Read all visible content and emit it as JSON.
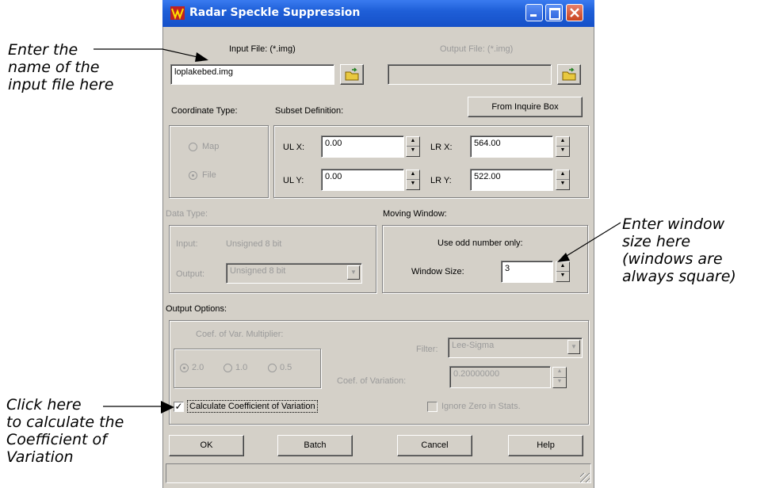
{
  "callouts": {
    "input": [
      "Enter the",
      "name of the",
      "input file here"
    ],
    "window": [
      "Enter window",
      "size here",
      "(windows are",
      "always square)"
    ],
    "coef": [
      "Click here",
      "to calculate the",
      "Coefficient of",
      "Variation"
    ]
  },
  "window": {
    "title": "Radar Speckle Suppression",
    "app_icon": "imagine-icon",
    "title_buttons": [
      "minimize",
      "maximize",
      "close"
    ]
  },
  "input_file": {
    "label": "Input File: (*.img)",
    "value": "loplakebed.img"
  },
  "output_file": {
    "label": "Output File: (*.img)",
    "value": ""
  },
  "from_inquire_box": "From Inquire Box",
  "coordinate_type": {
    "label": "Coordinate Type:",
    "options": [
      "Map",
      "File"
    ],
    "selected": "File"
  },
  "subset": {
    "label": "Subset Definition:",
    "ulx_label": "UL X:",
    "ulx": "0.00",
    "uly_label": "UL Y:",
    "uly": "0.00",
    "lrx_label": "LR X:",
    "lrx": "564.00",
    "lry_label": "LR Y:",
    "lry": "522.00"
  },
  "data_type": {
    "label": "Data Type:",
    "input_label": "Input:",
    "input_value": "Unsigned 8 bit",
    "output_label": "Output:",
    "output_value": "Unsigned 8 bit"
  },
  "moving_window": {
    "label": "Moving Window:",
    "hint": "Use odd number only:",
    "size_label": "Window Size:",
    "size": "3"
  },
  "output_options": {
    "label": "Output Options:",
    "multiplier_label": "Coef. of Var. Multiplier:",
    "multipliers": [
      "2.0",
      "1.0",
      "0.5"
    ],
    "multiplier_selected": "2.0",
    "filter_label": "Filter:",
    "filter_value": "Lee-Sigma",
    "coef_label": "Coef. of Variation:",
    "coef_value": "0.20000000",
    "calc_label": "Calculate Coefficient of Variation",
    "calc_checked": true,
    "ignore_zero_label": "Ignore Zero in Stats.",
    "ignore_zero_checked": false
  },
  "buttons": {
    "ok": "OK",
    "batch": "Batch",
    "cancel": "Cancel",
    "help": "Help"
  },
  "colors": {
    "titlebar": "#1f5fd8",
    "dialog": "#d4d0c8",
    "close_button": "#c8421f"
  }
}
